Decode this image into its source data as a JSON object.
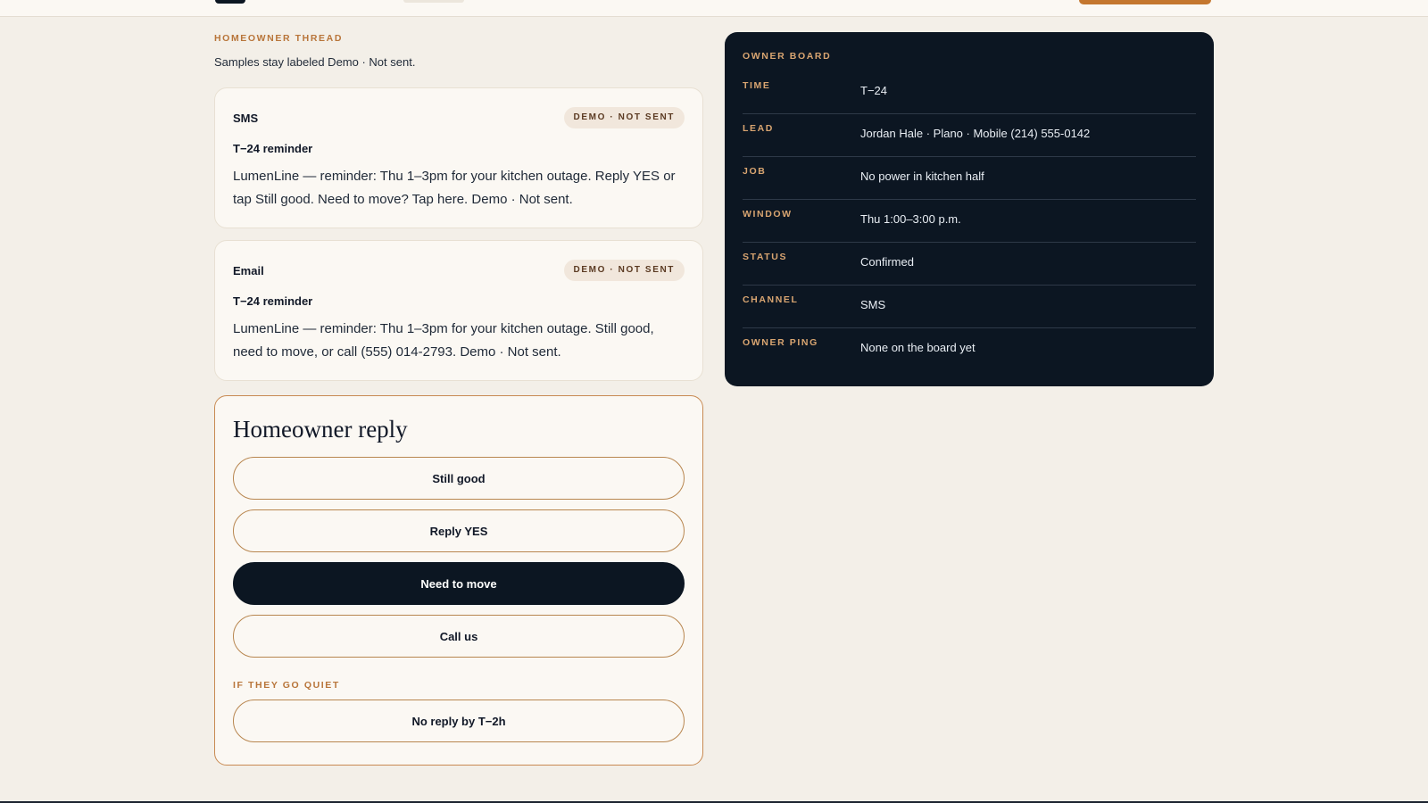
{
  "thread": {
    "label": "HOMEOWNER THREAD",
    "subtitle": "Samples stay labeled Demo · Not sent."
  },
  "messages": [
    {
      "channel": "SMS",
      "badge": "DEMO · NOT SENT",
      "title": "T−24 reminder",
      "body": "LumenLine — reminder: Thu 1–3pm for your kitchen outage. Reply YES or tap Still good. Need to move? Tap here. Demo · Not sent."
    },
    {
      "channel": "Email",
      "badge": "DEMO · NOT SENT",
      "title": "T−24 reminder",
      "body": "LumenLine — reminder: Thu 1–3pm for your kitchen outage. Still good, need to move, or call (555) 014-2793. Demo · Not sent."
    }
  ],
  "reply": {
    "heading": "Homeowner reply",
    "options": [
      {
        "label": "Still good",
        "active": false
      },
      {
        "label": "Reply YES",
        "active": false
      },
      {
        "label": "Need to move",
        "active": true
      },
      {
        "label": "Call us",
        "active": false
      }
    ],
    "quiet_label": "IF THEY GO QUIET",
    "quiet_option": "No reply by T−2h"
  },
  "board": {
    "title": "OWNER BOARD",
    "rows": [
      {
        "key": "TIME",
        "value": "T−24"
      },
      {
        "key": "LEAD",
        "value": "Jordan Hale · Plano · Mobile (214) 555-0142"
      },
      {
        "key": "JOB",
        "value": "No power in kitchen half"
      },
      {
        "key": "WINDOW",
        "value": "Thu 1:00–3:00 p.m."
      },
      {
        "key": "STATUS",
        "value": "Confirmed"
      },
      {
        "key": "CHANNEL",
        "value": "SMS"
      },
      {
        "key": "OWNER PING",
        "value": "None on the board yet"
      }
    ]
  },
  "colors": {
    "background": "#f3efe8",
    "card": "#fbf8f3",
    "accent": "#b8753a",
    "navy": "#0c1622"
  }
}
